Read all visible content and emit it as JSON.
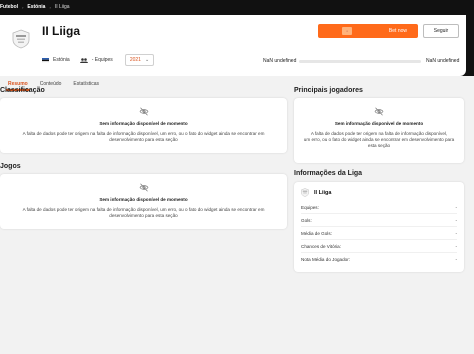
{
  "breadcrumb": [
    {
      "label": "Futebol"
    },
    {
      "label": "Estónia"
    },
    {
      "label": "II Liiga"
    }
  ],
  "league": {
    "title": "II Liiga",
    "country": "Estónia",
    "teams_label": "- Equipes",
    "season": "2021"
  },
  "actions": {
    "bet_label": "Bet now",
    "follow_label": "Seguir"
  },
  "odds": {
    "left": "NaN undefined",
    "right": "NaN undefined"
  },
  "tabs": [
    {
      "label": "Resumo",
      "active": true
    },
    {
      "label": "Conteúdo",
      "active": false
    },
    {
      "label": "Estatísticas",
      "active": false
    }
  ],
  "sections": {
    "classificacao": "Classificação",
    "jogos": "Jogos",
    "jogadores": "Principais jogadores",
    "info": "Informações da Liga"
  },
  "empty_state": {
    "title": "Sem informação disponível de momento",
    "text_wide_1": "A falta de dados pode ter origem na falta de informação disponível, um erro, ou o fato do widget ainda se encontrar em",
    "text_wide_2": "desenvolvimento para esta seção",
    "text_narrow_1": "A falta de dados pode ter origem na falta de informação disponível,",
    "text_narrow_2": "um erro, ou o fato do widget ainda se encontrar em desenvolvimento para",
    "text_narrow_3": "esta seção"
  },
  "league_info": {
    "name": "II Liiga",
    "rows": [
      {
        "label": "Equipes:",
        "value": "-"
      },
      {
        "label": "Gols:",
        "value": "-"
      },
      {
        "label": "Média de Gols:",
        "value": "-"
      },
      {
        "label": "Chances de Vitória:",
        "value": "-"
      },
      {
        "label": "Nota Média do Jogador:",
        "value": "-"
      }
    ]
  },
  "colors": {
    "accent": "#ff6a1a",
    "topbar": "#111111",
    "background": "#f2f2f2"
  },
  "icons": {
    "no_data": "eye-slash-icon",
    "logo": "league-logo",
    "flag": "flag-icon",
    "team": "teams-icon"
  }
}
